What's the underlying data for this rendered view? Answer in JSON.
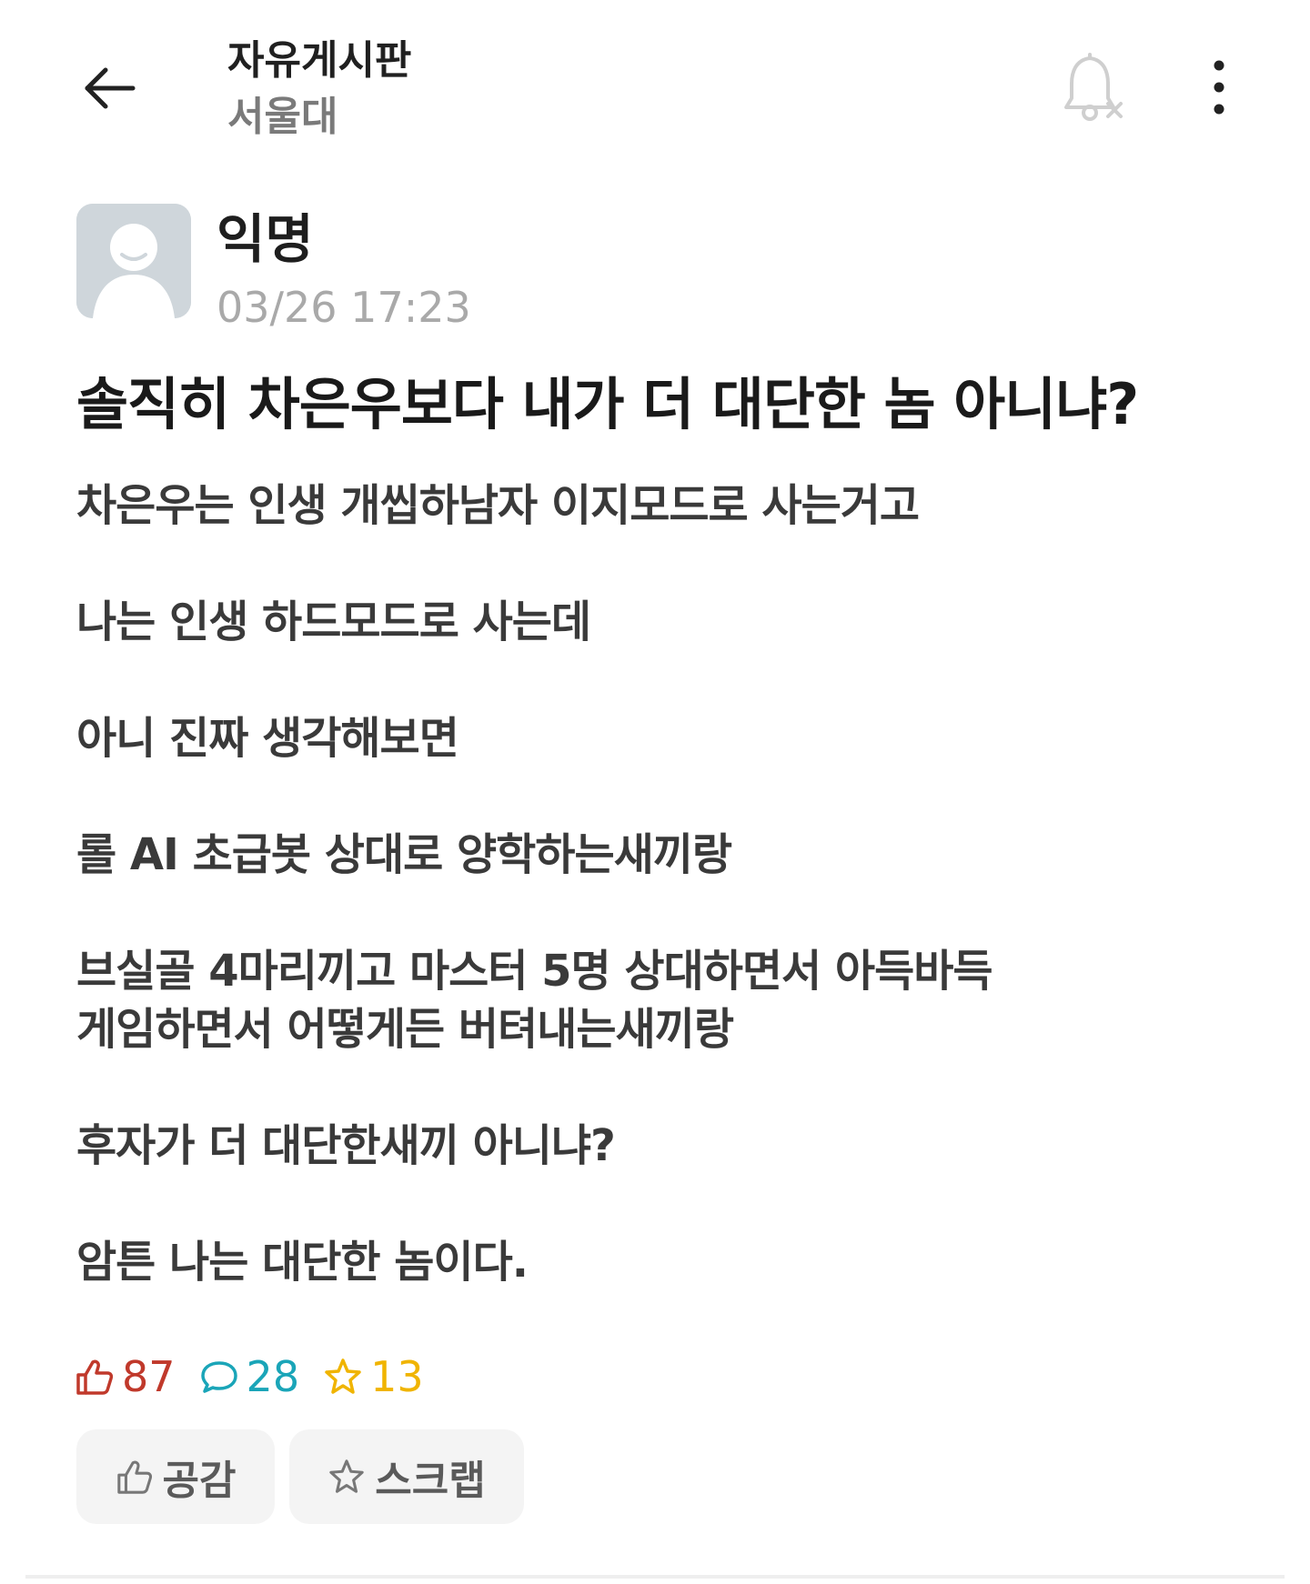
{
  "header": {
    "board_title": "자유게시판",
    "board_subtitle": "서울대",
    "back_icon": "arrow-left-icon",
    "bell_icon": "bell-off-icon",
    "more_icon": "more-vertical-icon"
  },
  "author": {
    "name": "익명",
    "time": "03/26 17:23",
    "avatar_icon": "anonymous-avatar-icon"
  },
  "post": {
    "title": "솔직히 차은우보다 내가 더 대단한 놈 아니냐?",
    "paragraphs": [
      [
        "차은우는 인생 개씹하남자 이지모드로 사는거고"
      ],
      [
        "나는 인생 하드모드로 사는데"
      ],
      [
        "아니 진짜 생각해보면"
      ],
      [
        "롤 AI 초급봇 상대로 양학하는새끼랑"
      ],
      [
        "브실골 4마리끼고 마스터 5명 상대하면서 아득바득",
        "게임하면서 어떻게든 버텨내는새끼랑"
      ],
      [
        "후자가 더 대단한새끼 아니냐?"
      ],
      [
        "암튼 나는 대단한 놈이다."
      ]
    ]
  },
  "stats": {
    "likes": "87",
    "comments": "28",
    "scraps": "13"
  },
  "actions": {
    "like_label": "공감",
    "scrap_label": "스크랩"
  },
  "colors": {
    "like": "#c0392b",
    "comment": "#1aa5b8",
    "scrap": "#f0b400",
    "muted": "#a9a9a9"
  }
}
